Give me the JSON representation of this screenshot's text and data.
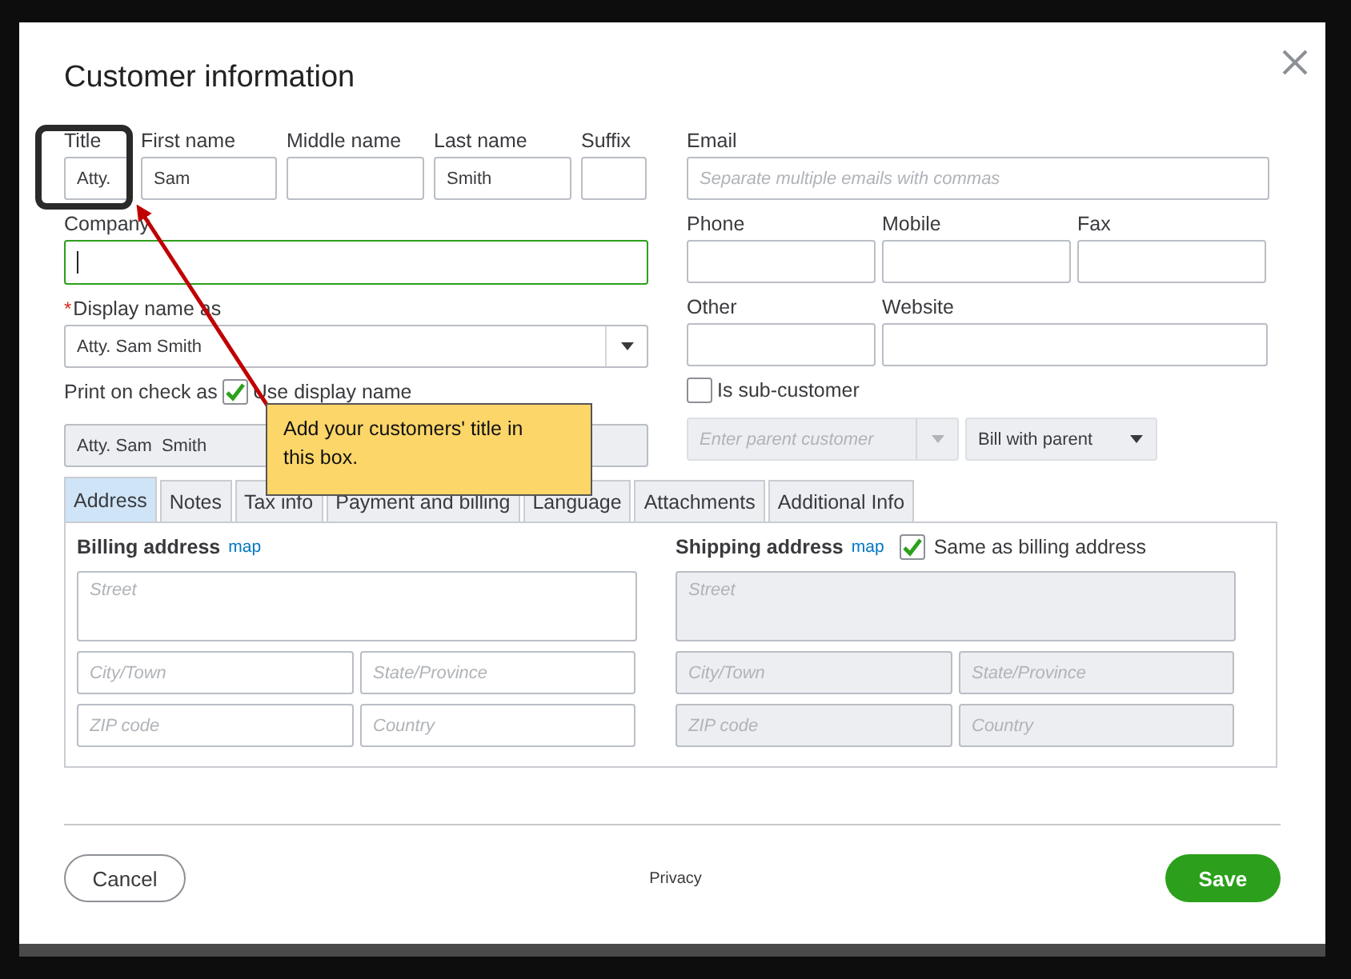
{
  "dialog": {
    "title": "Customer information"
  },
  "name_row": [
    {
      "label": "Title",
      "value": "Atty."
    },
    {
      "label": "First name",
      "value": "Sam"
    },
    {
      "label": "Middle name"
    },
    {
      "label": "Last name",
      "value": "Smith"
    },
    {
      "label": "Suffix"
    }
  ],
  "company": {
    "label": "Company",
    "focused": true
  },
  "display_name": {
    "label": "Display name as",
    "required_mark": "*",
    "value": "Atty. Sam  Smith"
  },
  "print_on_check": {
    "label": "Print on check as",
    "checkbox_label": "Use display name",
    "checked": true,
    "value": "Atty. Sam  Smith",
    "disabled": true
  },
  "email": {
    "label": "Email",
    "placeholder": "Separate multiple emails with commas"
  },
  "phone_row": [
    {
      "label": "Phone"
    },
    {
      "label": "Mobile"
    },
    {
      "label": "Fax"
    }
  ],
  "other_row": [
    {
      "label": "Other"
    },
    {
      "label": "Website"
    }
  ],
  "sub_customer": {
    "label": "Is sub-customer",
    "checked": false,
    "parent_placeholder": "Enter parent customer",
    "billing": "Bill with parent",
    "disabled": true
  },
  "tabs": [
    {
      "label": "Address",
      "selected": true
    },
    {
      "label": "Notes",
      "selected": false
    },
    {
      "label": "Tax info",
      "selected": false
    },
    {
      "label": "Payment and billing",
      "selected": false
    },
    {
      "label": "Language",
      "selected": false
    },
    {
      "label": "Attachments",
      "selected": false
    },
    {
      "label": "Additional Info",
      "selected": false
    }
  ],
  "billing_address": {
    "label": "Billing address",
    "link": "map",
    "disabled": false,
    "fields": [
      {
        "placeholder": "Street"
      },
      {
        "placeholder": "City/Town"
      },
      {
        "placeholder": "State/Province"
      },
      {
        "placeholder": "ZIP code"
      },
      {
        "placeholder": "Country"
      }
    ]
  },
  "shipping_address": {
    "label": "Shipping address",
    "link": "map",
    "same_as_billing": {
      "label": "Same as billing address",
      "checked": true
    },
    "disabled": true,
    "fields": [
      {
        "placeholder": "Street"
      },
      {
        "placeholder": "City/Town"
      },
      {
        "placeholder": "State/Province"
      },
      {
        "placeholder": "ZIP code"
      },
      {
        "placeholder": "Country"
      }
    ]
  },
  "footer": {
    "cancel": "Cancel",
    "privacy": "Privacy",
    "save": "Save"
  },
  "callout": {
    "text": "Add your customers' title in this box."
  }
}
